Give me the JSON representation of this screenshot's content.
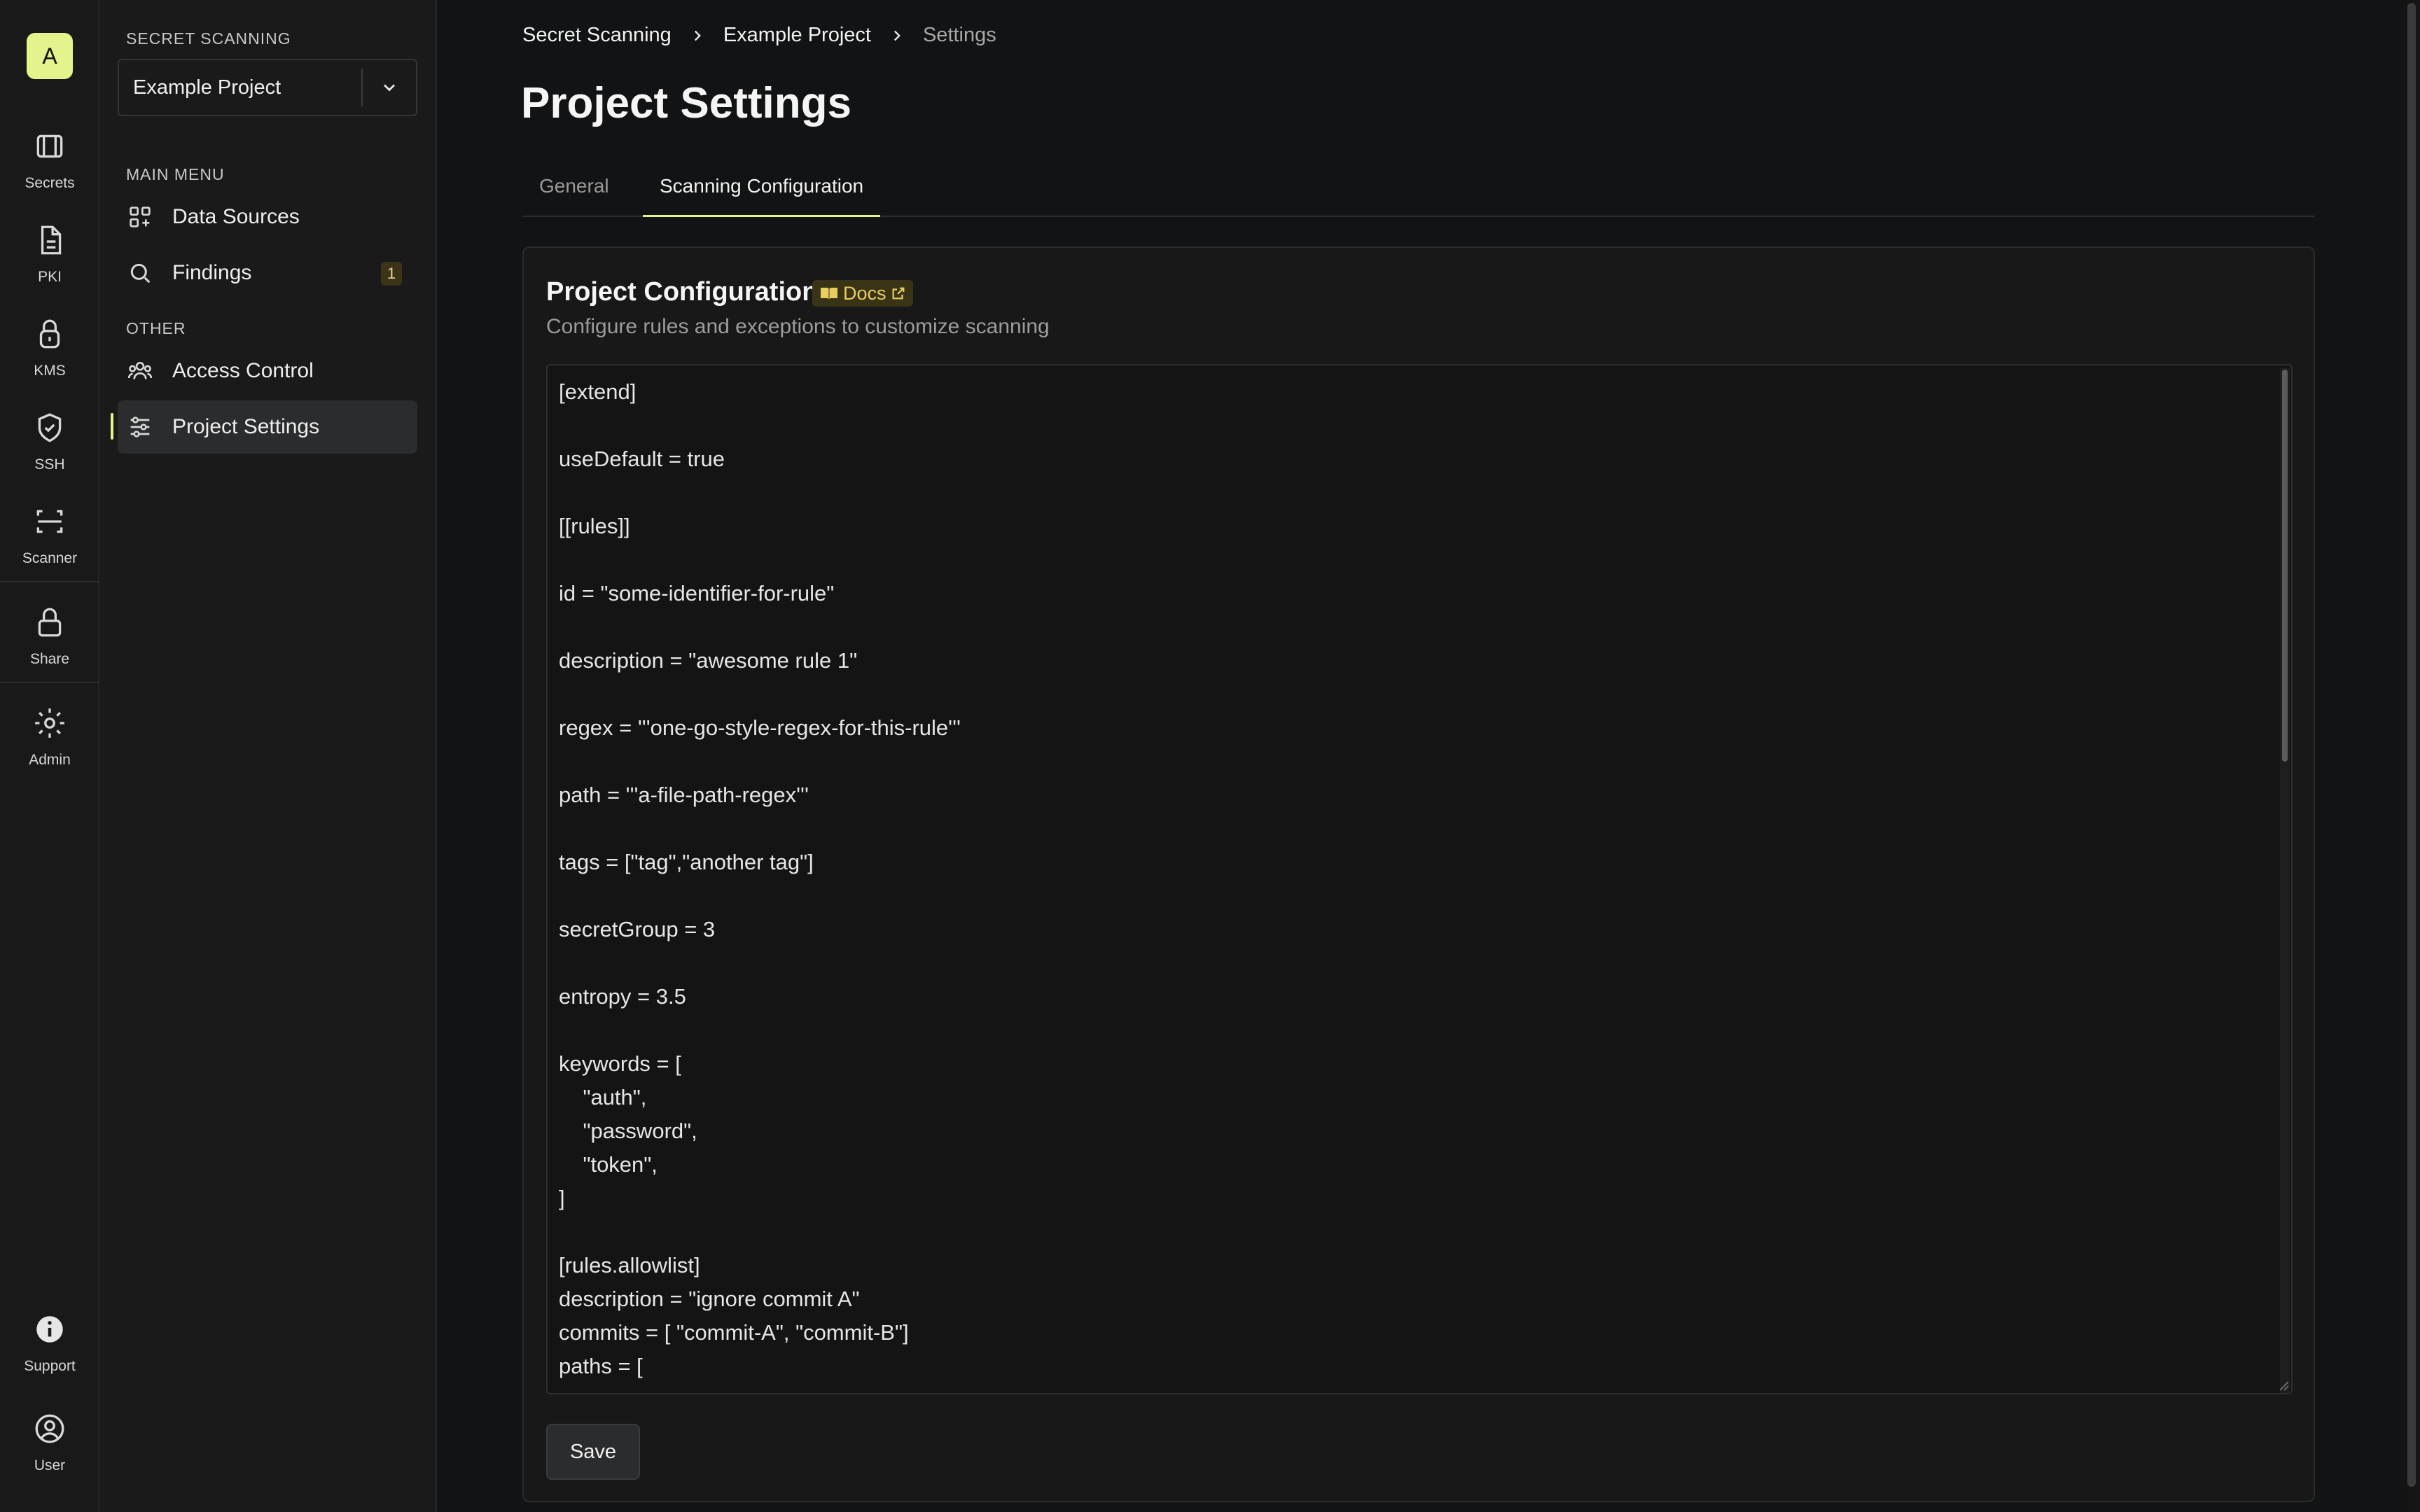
{
  "org": {
    "avatar_letter": "A"
  },
  "rail": {
    "items": [
      {
        "label": "Secrets",
        "icon": "vault-icon"
      },
      {
        "label": "PKI",
        "icon": "document-icon"
      },
      {
        "label": "KMS",
        "icon": "lock-fingerprint-icon"
      },
      {
        "label": "SSH",
        "icon": "shield-check-icon"
      },
      {
        "label": "Scanner",
        "icon": "scan-icon"
      },
      {
        "label": "Share",
        "icon": "lock-icon"
      },
      {
        "label": "Admin",
        "icon": "gear-icon"
      }
    ],
    "bottom": [
      {
        "label": "Support",
        "icon": "info-icon"
      },
      {
        "label": "User",
        "icon": "user-circle-icon"
      }
    ]
  },
  "sidebar": {
    "section_title": "SECRET SCANNING",
    "project_select_value": "Example Project",
    "main_menu_title": "MAIN MENU",
    "main_menu": [
      {
        "label": "Data Sources",
        "icon": "grid-plus-icon"
      },
      {
        "label": "Findings",
        "icon": "search-icon",
        "badge": "1"
      }
    ],
    "other_title": "OTHER",
    "other_menu": [
      {
        "label": "Access Control",
        "icon": "users-icon"
      },
      {
        "label": "Project Settings",
        "icon": "sliders-icon",
        "active": true
      }
    ]
  },
  "breadcrumb": [
    "Secret Scanning",
    "Example Project",
    "Settings"
  ],
  "page_title": "Project Settings",
  "tabs": [
    {
      "label": "General",
      "active": false
    },
    {
      "label": "Scanning Configuration",
      "active": true
    }
  ],
  "card": {
    "title": "Project Configuration",
    "docs_label": "Docs",
    "subtitle": "Configure rules and exceptions to customize scanning",
    "config_text": "[extend]\n\nuseDefault = true\n\n[[rules]]\n\nid = \"some-identifier-for-rule\"\n\ndescription = \"awesome rule 1\"\n\nregex = '''one-go-style-regex-for-this-rule'''\n\npath = '''a-file-path-regex'''\n\ntags = [\"tag\",\"another tag\"]\n\nsecretGroup = 3\n\nentropy = 3.5\n\nkeywords = [\n    \"auth\",\n    \"password\",\n    \"token\",\n]\n\n[rules.allowlist]\ndescription = \"ignore commit A\"\ncommits = [ \"commit-A\", \"commit-B\"]\npaths = [\n    '''go\\.mod''',",
    "save_label": "Save"
  },
  "colors": {
    "accent": "#e4f38b",
    "background": "#121314",
    "sidebar": "#1a1a1b",
    "docs_badge_text": "#e9cd5f"
  }
}
